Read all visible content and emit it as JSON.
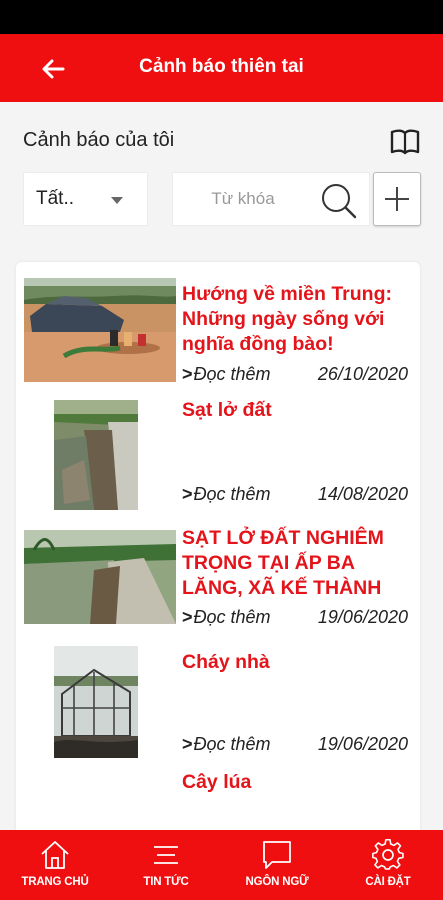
{
  "header": {
    "title": "Cảnh báo thiên tai"
  },
  "section": {
    "title": "Cảnh báo của tôi"
  },
  "filter": {
    "selected": "Tất.."
  },
  "search": {
    "placeholder": "Từ khóa"
  },
  "read_more_label": "Đọc thêm",
  "news": [
    {
      "title": "Hướng về miền Trung: Những ngày sống với nghĩa đồng bào!",
      "date": "26/10/2020"
    },
    {
      "title": "Sạt lở đất",
      "date": "14/08/2020"
    },
    {
      "title": "SẠT LỞ ĐẤT NGHIÊM TRỌNG TẠI ẤP BA LĂNG, XÃ KẾ THÀNH",
      "date": "19/06/2020"
    },
    {
      "title": "Cháy nhà",
      "date": "19/06/2020"
    },
    {
      "title": "Cây lúa"
    }
  ],
  "nav": [
    {
      "label": "TRANG CHỦ",
      "icon": "home-icon"
    },
    {
      "label": "TIN TỨC",
      "icon": "news-icon"
    },
    {
      "label": "NGÔN NGỮ",
      "icon": "language-icon"
    },
    {
      "label": "CÀI ĐẶT",
      "icon": "settings-icon"
    }
  ],
  "colors": {
    "accent": "#ef0f10",
    "title_red": "#e4141b"
  }
}
